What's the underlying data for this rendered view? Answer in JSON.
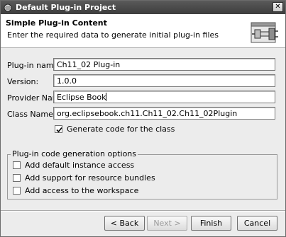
{
  "window": {
    "title": "Default Plug-in Project"
  },
  "header": {
    "title": "Simple Plug-in Content",
    "description": "Enter the required data to generate initial plug-in files",
    "banner_icon": "plugin-wizard-icon"
  },
  "form": {
    "plugin_name": {
      "label": "Plug-in name:",
      "value": "Ch11_02 Plug-in"
    },
    "version": {
      "label": "Version:",
      "value": "1.0.0"
    },
    "provider_name": {
      "label": "Provider Name:",
      "value": "Eclipse Book"
    },
    "class_name": {
      "label": "Class Name:",
      "value": "org.eclipsebook.ch11.Ch11_02.Ch11_02Plugin"
    },
    "generate_code": {
      "label": "Generate code for the class",
      "checked": true
    }
  },
  "options_group": {
    "legend": "Plug-in code generation options",
    "options": [
      {
        "label": "Add default instance access",
        "checked": false
      },
      {
        "label": "Add support for resource bundles",
        "checked": false
      },
      {
        "label": "Add access to the workspace",
        "checked": false
      }
    ]
  },
  "buttons": {
    "back": "< Back",
    "next": "Next >",
    "finish": "Finish",
    "cancel": "Cancel"
  }
}
